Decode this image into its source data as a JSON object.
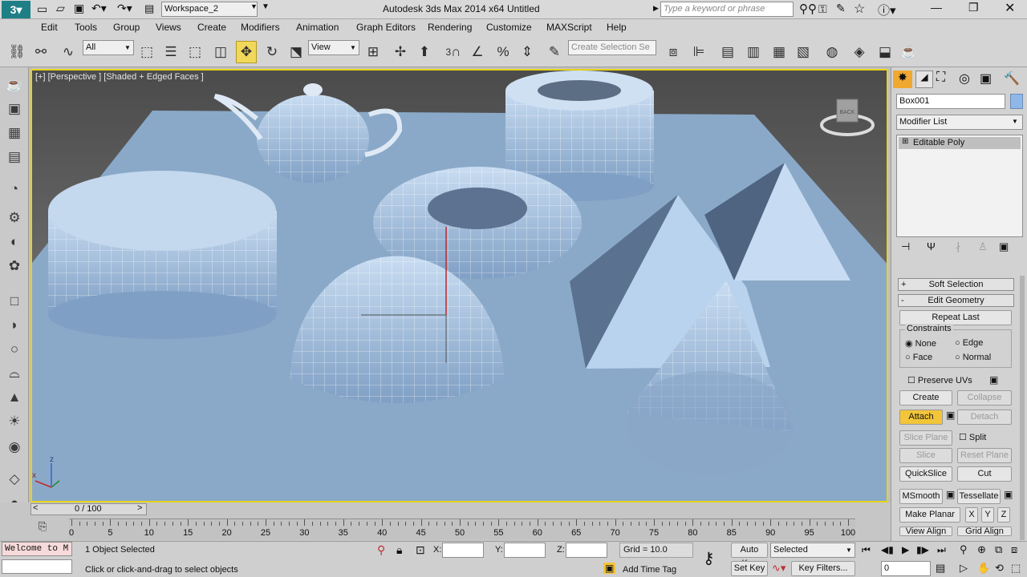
{
  "titlebar": {
    "workspace": "Workspace_2",
    "app_title": "Autodesk 3ds Max  2014 x64",
    "file_name": "Untitled",
    "search_placeholder": "Type a keyword or phrase"
  },
  "menu": [
    "Edit",
    "Tools",
    "Group",
    "Views",
    "Create",
    "Modifiers",
    "Animation",
    "Graph Editors",
    "Rendering",
    "Customize",
    "MAXScript",
    "Help"
  ],
  "toolbar": {
    "selection_filter": "All",
    "ref_coord": "View",
    "selection_set_placeholder": "Create Selection Se",
    "snap_label": "3"
  },
  "viewport": {
    "label": "[+] [Perspective ] [Shaded + Edged Faces ]",
    "viewcube_face": "BACK",
    "axis_x": "x",
    "axis_z": "z",
    "bg_color": "#8aa9c8",
    "selection_color": "#e6d31a"
  },
  "command_panel": {
    "object_name": "Box001",
    "object_color": "#8fb8e8",
    "modifier_list": "Modifier List",
    "stack_item": "Editable Poly",
    "rollouts": {
      "soft_selection": "Soft Selection",
      "edit_geometry": "Edit Geometry"
    },
    "repeat_last": "Repeat Last",
    "constraints_label": "Constraints",
    "constraints": {
      "none": "None",
      "edge": "Edge",
      "face": "Face",
      "normal": "Normal"
    },
    "preserve_uvs": "Preserve UVs",
    "create": "Create",
    "collapse": "Collapse",
    "attach": "Attach",
    "detach": "Detach",
    "slice_plane": "Slice Plane",
    "split": "Split",
    "slice": "Slice",
    "reset_plane": "Reset Plane",
    "quickslice": "QuickSlice",
    "cut": "Cut",
    "msmooth": "MSmooth",
    "tessellate": "Tessellate",
    "make_planar": "Make Planar",
    "x": "X",
    "y": "Y",
    "z": "Z",
    "view_align": "View Align",
    "grid_align": "Grid Align"
  },
  "timeline": {
    "frame": "0 / 100",
    "prev": "<",
    "next": ">",
    "ticks": [
      "0",
      "5",
      "10",
      "15",
      "20",
      "25",
      "30",
      "35",
      "40",
      "45",
      "50",
      "55",
      "60",
      "65",
      "70",
      "75",
      "80",
      "85",
      "90",
      "95",
      "100"
    ]
  },
  "status": {
    "maxscript": "Welcome to M",
    "selected": "1 Object Selected",
    "prompt": "Click or click-and-drag to select objects",
    "x_label": "X:",
    "y_label": "Y:",
    "z_label": "Z:",
    "grid": "Grid = 10.0",
    "add_time_tag": "Add Time Tag",
    "auto_key": "Auto Key",
    "set_key": "Set Key",
    "key_mode": "Selected",
    "key_filters": "Key Filters...",
    "current_frame": "0"
  }
}
